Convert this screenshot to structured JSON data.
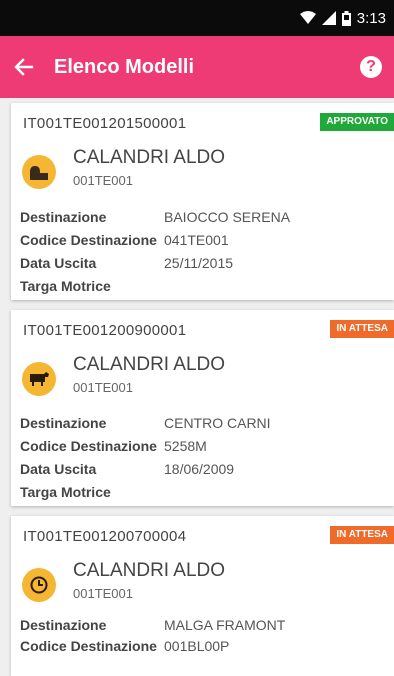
{
  "status_bar": {
    "time": "3:13",
    "wifi_icon": "wifi-icon",
    "signal_icon": "signal-icon",
    "battery_icon": "battery-icon"
  },
  "app_bar": {
    "title": "Elenco Modelli",
    "back_icon": "arrow-left-icon",
    "help_icon": "help-icon",
    "color": "#ee3a75"
  },
  "labels": {
    "destinazione": "Destinazione",
    "codice_destinazione": "Codice Destinazione",
    "data_uscita": "Data Uscita",
    "targa_motrice": "Targa Motrice"
  },
  "status_colors": {
    "APPROVATO": "#20a83a",
    "IN ATTESA": "#f06a2a"
  },
  "cards": [
    {
      "code": "IT001TE001201500001",
      "status": "APPROVATO",
      "icon": "farm-building-icon",
      "name": "CALANDRI ALDO",
      "subcode": "001TE001",
      "destinazione": "BAIOCCO SERENA",
      "codice_destinazione": "041TE001",
      "data_uscita": "25/11/2015",
      "targa_motrice": ""
    },
    {
      "code": "IT001TE001200900001",
      "status": "IN ATTESA",
      "icon": "cow-icon",
      "name": "CALANDRI ALDO",
      "subcode": "001TE001",
      "destinazione": "CENTRO CARNI",
      "codice_destinazione": "5258M",
      "data_uscita": "18/06/2009",
      "targa_motrice": ""
    },
    {
      "code": "IT001TE001200700004",
      "status": "IN ATTESA",
      "icon": "clock-icon",
      "name": "CALANDRI ALDO",
      "subcode": "001TE001",
      "destinazione": "MALGA FRAMONT",
      "codice_destinazione": "001BL00P",
      "data_uscita": "",
      "targa_motrice": ""
    }
  ]
}
